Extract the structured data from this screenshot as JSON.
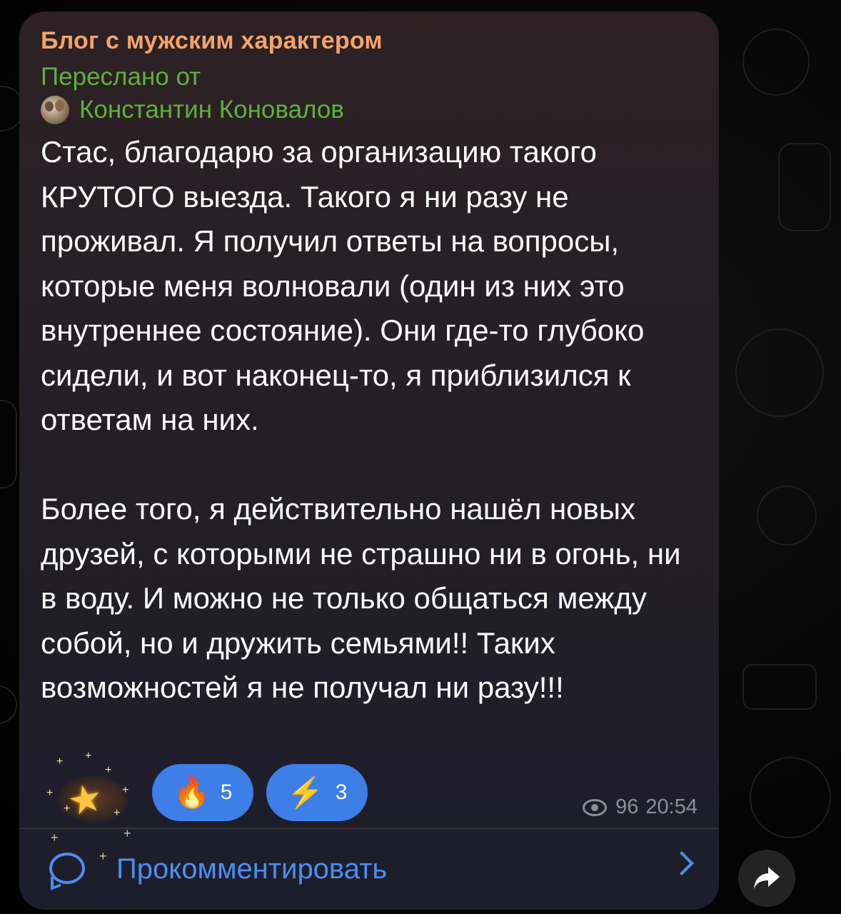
{
  "message": {
    "channel_name": "Блог с мужским характером",
    "forwarded_label": "Переслано от",
    "forwarded_author": "Константин Коновалов",
    "text": "Стас, благодарю за организацию такого КРУТОГО выезда. Такого я ни разу не проживал. Я получил ответы на вопросы, которые меня волновали (один из них это внутреннее состояние). Они где-то глубоко сидели, и вот наконец-то, я приблизился к ответам на них.\n\nБолее того, я действительно нашёл новых друзей, с которыми не страшно ни в огонь, ни в воду. И можно не только общаться между собой, но и дружить семьями!! Таких возможностей я не получал ни разу!!!",
    "views": "96",
    "time": "20:54"
  },
  "reactions": [
    {
      "emoji_name": "fire-icon",
      "emoji": "🔥",
      "count": "5"
    },
    {
      "emoji_name": "lightning-icon",
      "emoji": "⚡",
      "count": "3"
    }
  ],
  "comment": {
    "label": "Прокомментировать"
  },
  "colors": {
    "channel_name": "#f3a36b",
    "forwarded": "#5fb13c",
    "accent": "#4a8ff2",
    "reaction_pill": "#3d7ee8",
    "bubble": "#2a2128",
    "meta": "#8d8f98"
  }
}
